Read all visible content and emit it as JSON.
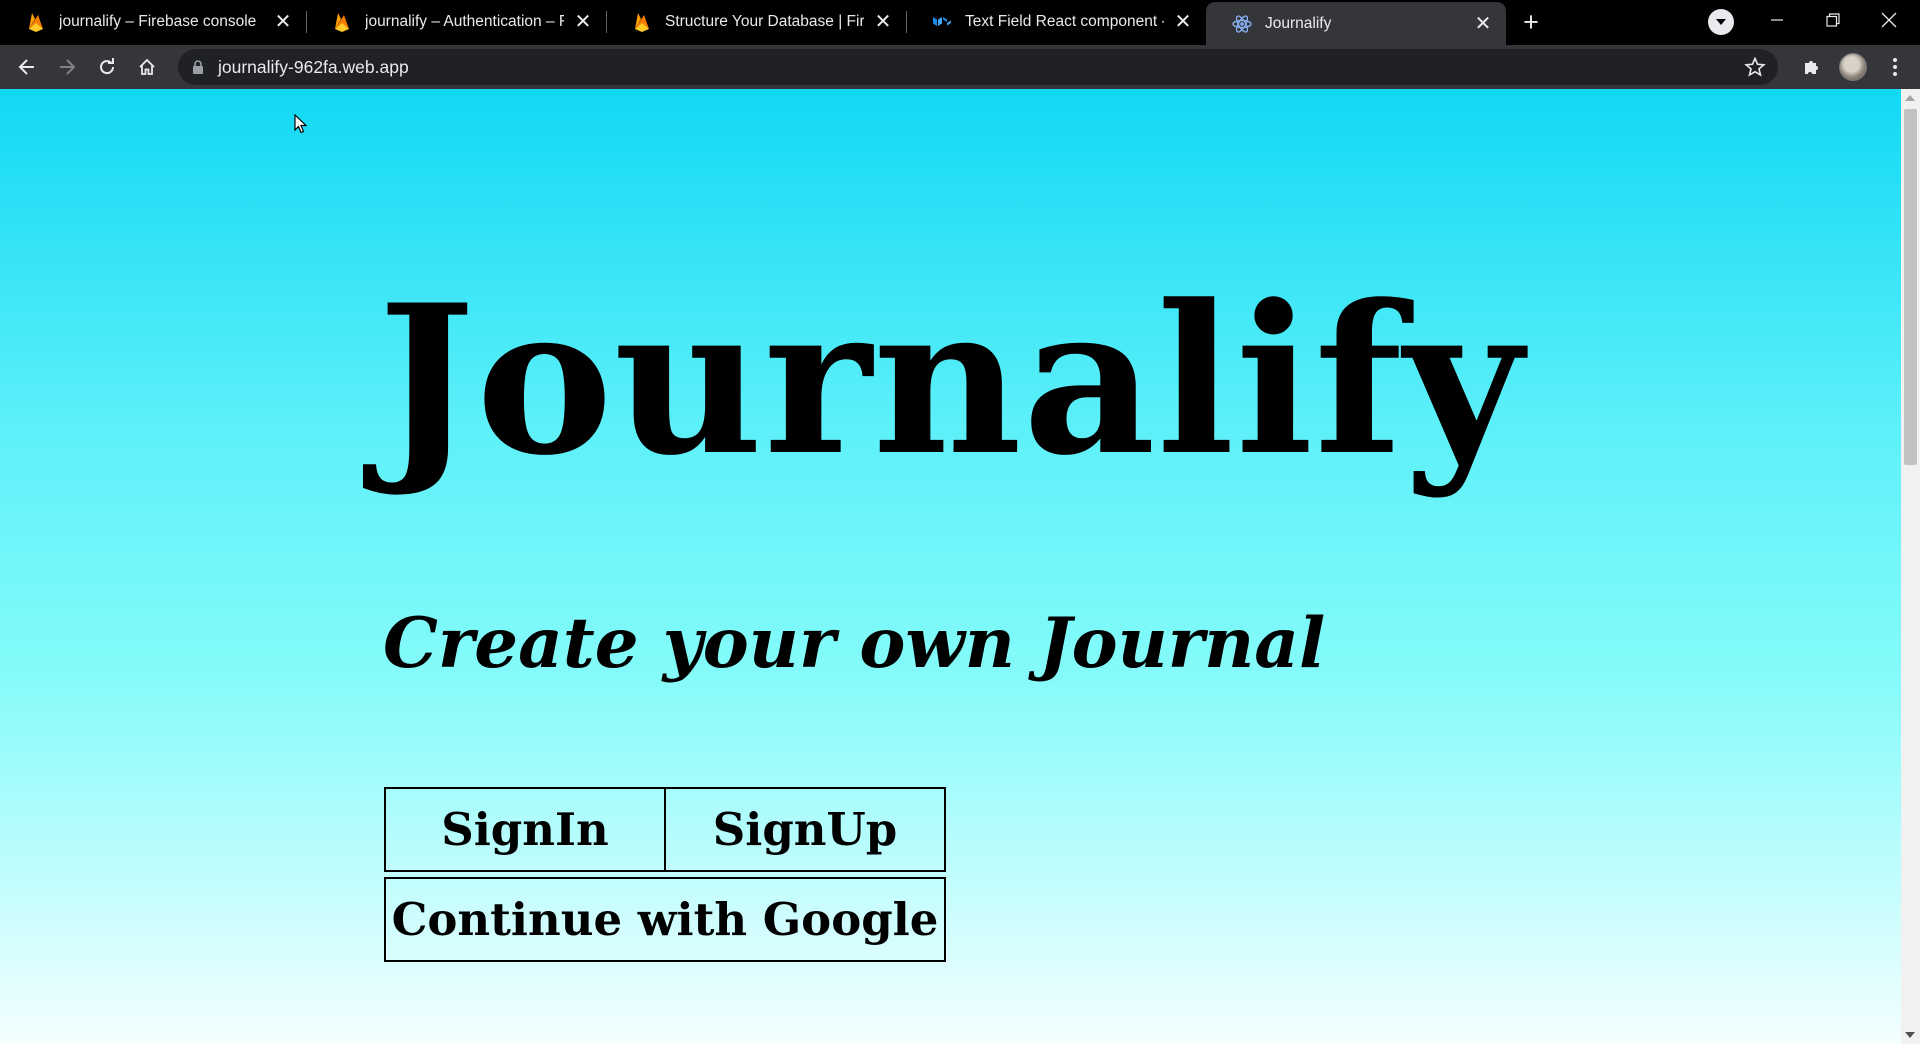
{
  "browser": {
    "tabs": [
      {
        "title": "journalify – Firebase console",
        "icon": "firebase-icon",
        "active": false
      },
      {
        "title": "journalify – Authentication – Fire",
        "icon": "firebase-icon",
        "active": false
      },
      {
        "title": "Structure Your Database  |  Fireba",
        "icon": "firebase-icon",
        "active": false
      },
      {
        "title": "Text Field React component - Ma",
        "icon": "mui-icon",
        "active": false
      },
      {
        "title": "Journalify",
        "icon": "react-icon",
        "active": true
      }
    ],
    "url": "journalify-962fa.web.app"
  },
  "page": {
    "title": "Journalify",
    "subtitle": "Create your own Journal",
    "signin_label": "SignIn",
    "signup_label": "SignUp",
    "google_label": "Continue with Google"
  },
  "colors": {
    "gradient_top": "#12d8f4",
    "gradient_bottom": "#f4feff",
    "chrome_dark": "#000000",
    "chrome_toolbar": "#35363a"
  }
}
